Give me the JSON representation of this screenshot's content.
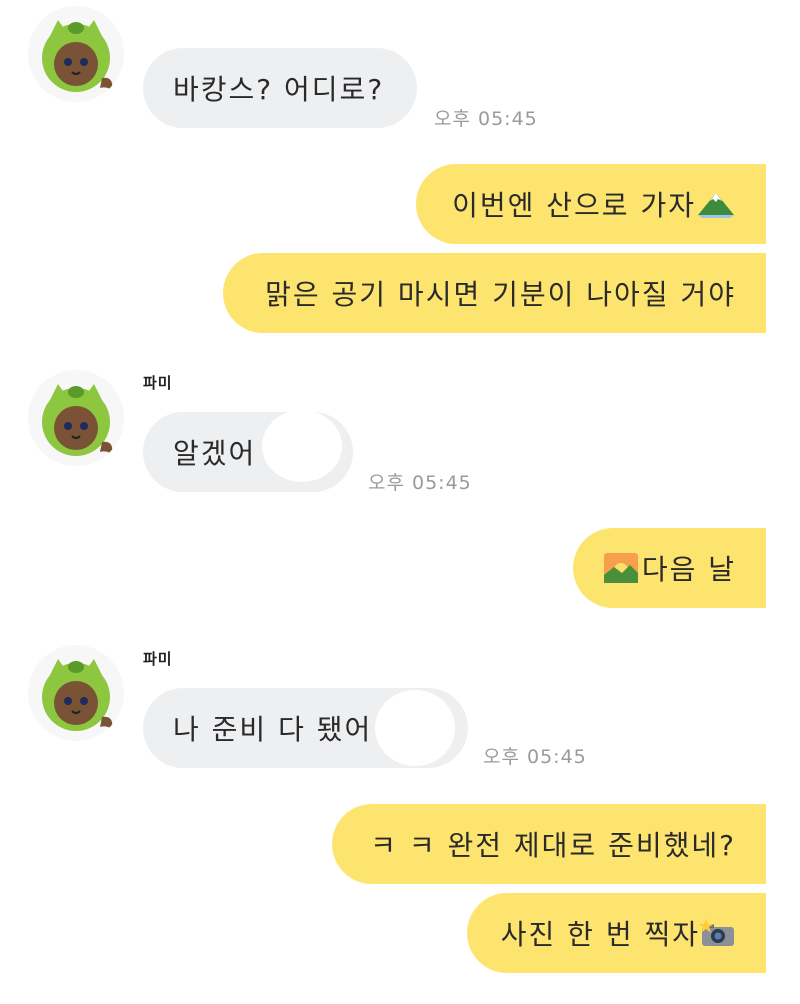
{
  "theme": {
    "incoming_bubble": "#eeeff1",
    "outgoing_bubble": "#fde46f",
    "time_color": "#9a9a9a"
  },
  "messages": [
    {
      "direction": "incoming",
      "sender": "",
      "text": "바캉스? 어디로?",
      "time": "오후 05:45"
    },
    {
      "direction": "outgoing",
      "text": "이번엔 산으로 가자",
      "emoji": "mountain-icon"
    },
    {
      "direction": "outgoing",
      "text": "맑은 공기 마시면 기분이 나아질 거야"
    },
    {
      "direction": "incoming",
      "sender": "파미",
      "text": "알겠어",
      "time": "오후 05:45"
    },
    {
      "direction": "outgoing",
      "text": "다음 날",
      "emoji_before": "sunrise-icon"
    },
    {
      "direction": "incoming",
      "sender": "파미",
      "text": "나 준비 다 됐어",
      "time": "오후 05:45"
    },
    {
      "direction": "outgoing",
      "text": "ㅋ ㅋ 완전 제대로 준비했네?"
    },
    {
      "direction": "outgoing",
      "text": "사진 한 번 찍자",
      "emoji": "camera-flash-icon"
    }
  ]
}
